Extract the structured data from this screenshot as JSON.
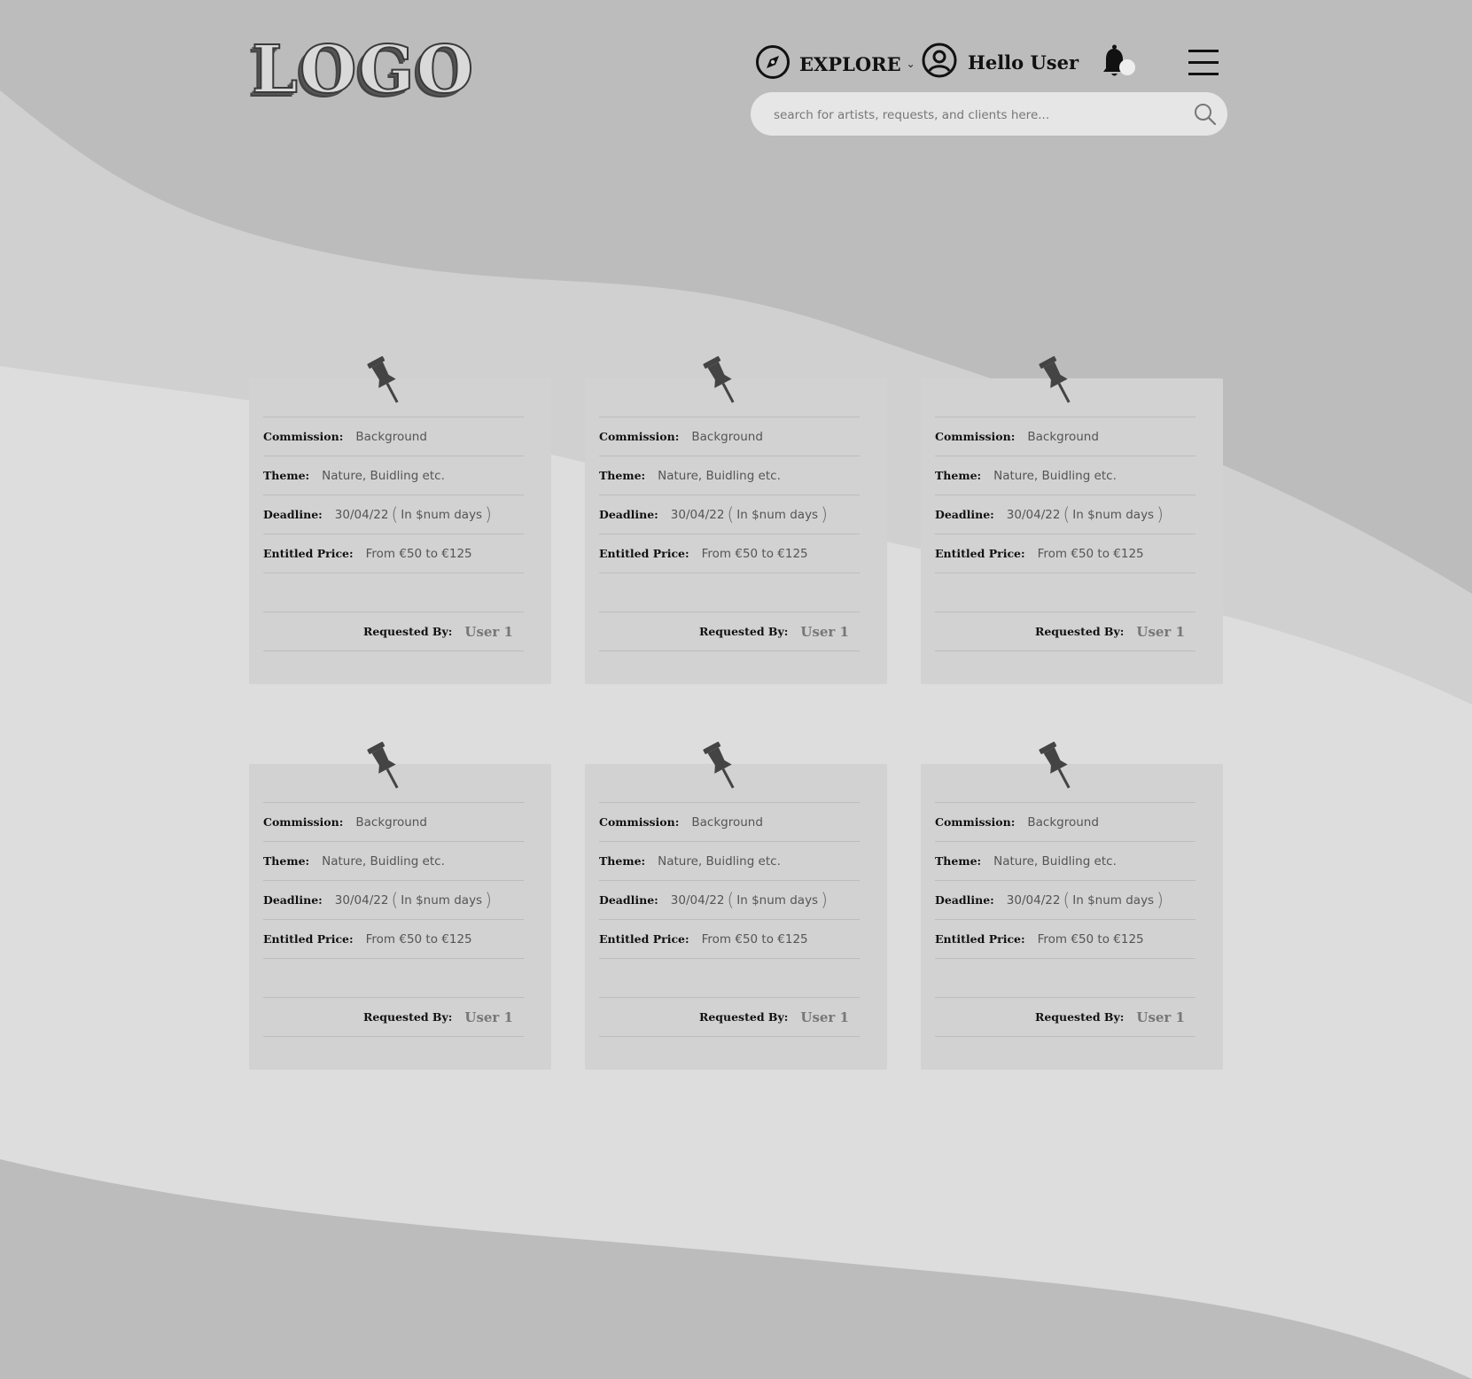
{
  "header": {
    "logo": "LOGO",
    "explore_label": "EXPLORE",
    "user_label": "Hello User",
    "search_placeholder": "search for artists, requests, and clients here..."
  },
  "labels": {
    "commission": "Commission:",
    "theme": "Theme:",
    "deadline": "Deadline:",
    "price": "Entitled Price:",
    "requested_by": "Requested By:"
  },
  "cards": [
    {
      "commission": "Background",
      "theme": "Nature, Buidling etc.",
      "deadline": "30/04/22",
      "deadline_rel": "In $num days",
      "price": "From €50 to €125",
      "requested_by": "User 1"
    },
    {
      "commission": "Background",
      "theme": "Nature, Buidling etc.",
      "deadline": "30/04/22",
      "deadline_rel": "In $num days",
      "price": "From €50 to €125",
      "requested_by": "User 1"
    },
    {
      "commission": "Background",
      "theme": "Nature, Buidling etc.",
      "deadline": "30/04/22",
      "deadline_rel": "In $num days",
      "price": "From €50 to €125",
      "requested_by": "User 1"
    },
    {
      "commission": "Background",
      "theme": "Nature, Buidling etc.",
      "deadline": "30/04/22",
      "deadline_rel": "In $num days",
      "price": "From €50 to €125",
      "requested_by": "User 1"
    },
    {
      "commission": "Background",
      "theme": "Nature, Buidling etc.",
      "deadline": "30/04/22",
      "deadline_rel": "In $num days",
      "price": "From €50 to €125",
      "requested_by": "User 1"
    },
    {
      "commission": "Background",
      "theme": "Nature, Buidling etc.",
      "deadline": "30/04/22",
      "deadline_rel": "In $num days",
      "price": "From €50 to €125",
      "requested_by": "User 1"
    }
  ],
  "colors": {
    "background_dark": "#bcbcbc",
    "background_mid": "#d0d0d0",
    "background_light": "#dddddd",
    "card": "#d2d2d2",
    "search": "#e6e6e6"
  }
}
